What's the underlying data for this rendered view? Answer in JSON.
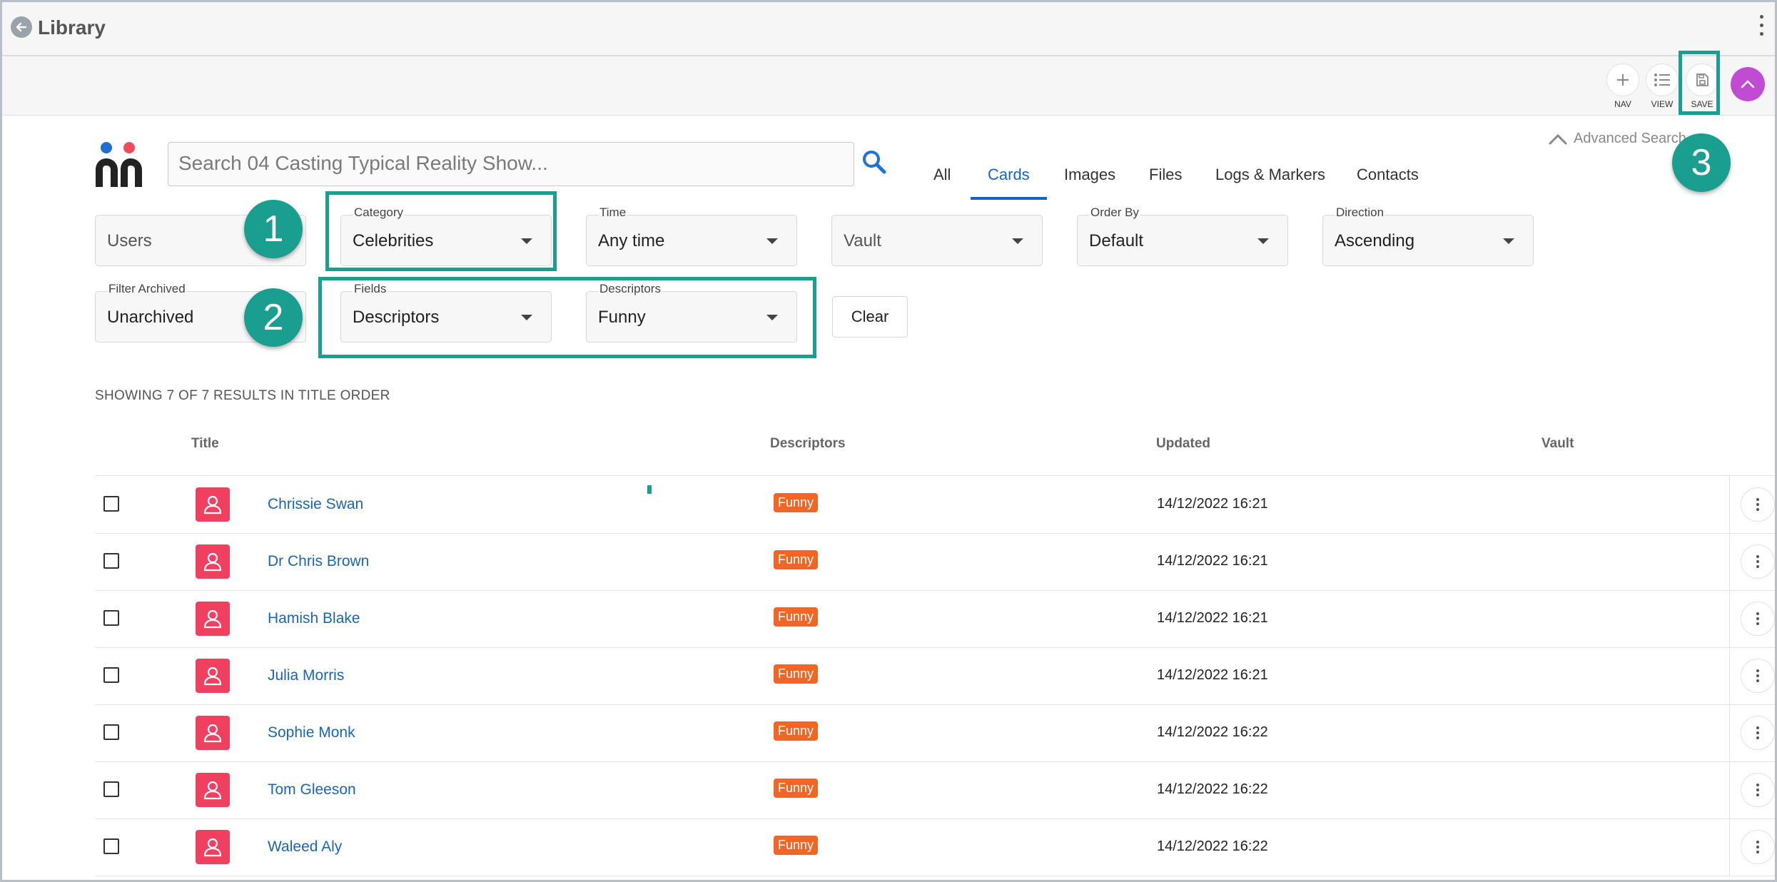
{
  "app": {
    "title": "Library"
  },
  "toolbar": {
    "nav_label": "NAV",
    "view_label": "VIEW",
    "save_label": "SAVE"
  },
  "search": {
    "placeholder": "Search 04 Casting Typical Reality Show...",
    "value": ""
  },
  "tabs": [
    {
      "label": "All"
    },
    {
      "label": "Cards"
    },
    {
      "label": "Images"
    },
    {
      "label": "Files"
    },
    {
      "label": "Logs & Markers"
    },
    {
      "label": "Contacts"
    }
  ],
  "active_tab": "Cards",
  "advanced_search": "Advanced Search",
  "callouts": [
    "1",
    "2",
    "3"
  ],
  "filters": {
    "users": {
      "value": "Users"
    },
    "category": {
      "label": "Category",
      "value": "Celebrities"
    },
    "time": {
      "label": "Time",
      "value": "Any time"
    },
    "vault": {
      "value": "Vault"
    },
    "order_by": {
      "label": "Order By",
      "value": "Default"
    },
    "direction": {
      "label": "Direction",
      "value": "Ascending"
    },
    "filter_archived": {
      "label": "Filter Archived",
      "value": "Unarchived"
    },
    "fields": {
      "label": "Fields",
      "value": "Descriptors"
    },
    "descriptors": {
      "label": "Descriptors",
      "value": "Funny"
    },
    "clear_label": "Clear"
  },
  "results_summary": "SHOWING 7 OF 7 RESULTS IN TITLE ORDER",
  "table": {
    "columns": [
      "Title",
      "Descriptors",
      "Updated",
      "Vault"
    ],
    "rows": [
      {
        "title": "Chrissie Swan",
        "descriptor": "Funny",
        "updated": "14/12/2022 16:21",
        "vault": ""
      },
      {
        "title": "Dr Chris Brown",
        "descriptor": "Funny",
        "updated": "14/12/2022 16:21",
        "vault": ""
      },
      {
        "title": "Hamish Blake",
        "descriptor": "Funny",
        "updated": "14/12/2022 16:21",
        "vault": ""
      },
      {
        "title": "Julia Morris",
        "descriptor": "Funny",
        "updated": "14/12/2022 16:21",
        "vault": ""
      },
      {
        "title": "Sophie Monk",
        "descriptor": "Funny",
        "updated": "14/12/2022 16:22",
        "vault": ""
      },
      {
        "title": "Tom Gleeson",
        "descriptor": "Funny",
        "updated": "14/12/2022 16:22",
        "vault": ""
      },
      {
        "title": "Waleed Aly",
        "descriptor": "Funny",
        "updated": "14/12/2022 16:22",
        "vault": ""
      }
    ]
  },
  "colors": {
    "accent": "#1565c0",
    "highlight": "#1a9e8f",
    "badge": "#f26522",
    "avatar": "#f04060",
    "fab": "#c24bd4"
  },
  "icons": [
    "back-arrow-icon",
    "more-vert-icon",
    "plus-icon",
    "list-icon",
    "save-icon",
    "chevron-up-icon",
    "search-icon",
    "person-icon"
  ]
}
